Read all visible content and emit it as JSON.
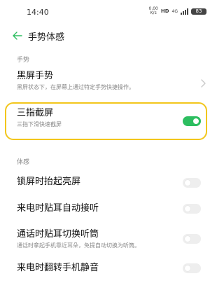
{
  "status_bar": {
    "time": "14:40",
    "net_speed_top": "0.00",
    "net_speed_bottom": "K/s",
    "hd": "HD",
    "network": "4G",
    "battery": "83"
  },
  "header": {
    "title": "手势体感"
  },
  "sections": {
    "gestures": "手势",
    "motion": "体感"
  },
  "gesture_items": {
    "screen_off": {
      "title": "黑屏手势",
      "subtitle": "黑屏状态下，在屏幕上通过特定手势快捷操作。"
    },
    "three_finger": {
      "title": "三指截屏",
      "subtitle": "三指下滑快速截屏",
      "enabled": true
    }
  },
  "motion_items": {
    "raise_to_wake": {
      "title": "锁屏时抬起亮屏",
      "enabled": false
    },
    "auto_answer": {
      "title": "来电时贴耳自动接听",
      "enabled": false
    },
    "switch_earpiece": {
      "title": "通话时贴耳切换听筒",
      "subtitle": "通话时拿起手机靠近耳朵，免提自动切换为听筒。",
      "enabled": false
    },
    "flip_to_mute": {
      "title": "来电时翻转手机静音",
      "enabled": false
    }
  },
  "colors": {
    "accent": "#2dbe60",
    "highlight": "#f2c61c"
  }
}
